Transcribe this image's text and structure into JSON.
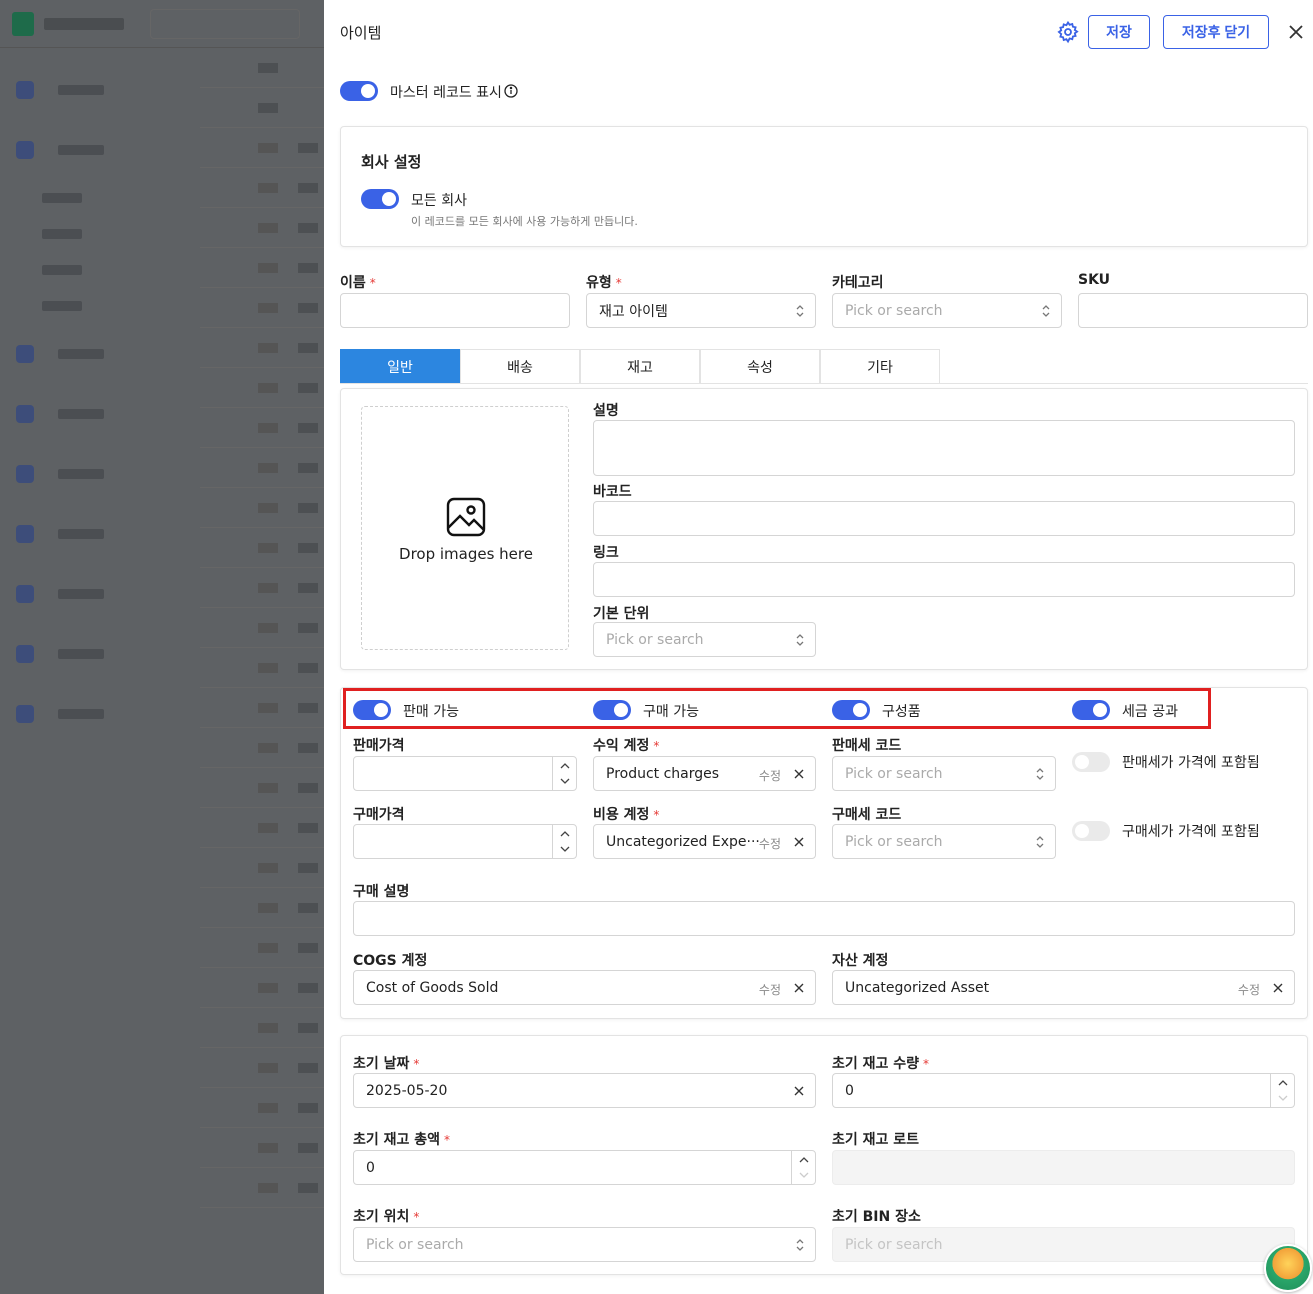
{
  "panel": {
    "title": "아이템",
    "save_label": "저장",
    "save_close_label": "저장후 닫기"
  },
  "master": {
    "toggle_label": "마스터 레코드 표시",
    "on": true
  },
  "company": {
    "heading": "회사 설정",
    "all_label": "모든 회사",
    "all_hint": "이 레코드를 모든 회사에 사용 가능하게 만듭니다.",
    "all_on": true
  },
  "top_fields": {
    "name": {
      "label": "이름",
      "value": ""
    },
    "type": {
      "label": "유형",
      "value": "재고 아이템"
    },
    "category": {
      "label": "카테고리",
      "placeholder": "Pick or search"
    },
    "sku": {
      "label": "SKU",
      "value": ""
    }
  },
  "tabs": [
    "일반",
    "배송",
    "재고",
    "속성",
    "기타"
  ],
  "active_tab": "일반",
  "general": {
    "drop_text": "Drop images here",
    "description_label": "설명",
    "barcode_label": "바코드",
    "link_label": "링크",
    "unit_label": "기본 단위",
    "unit_placeholder": "Pick or search"
  },
  "flags": [
    {
      "label": "판매 가능",
      "on": true
    },
    {
      "label": "구매 가능",
      "on": true
    },
    {
      "label": "구성품",
      "on": true
    },
    {
      "label": "세금 공과",
      "on": true
    }
  ],
  "pricing": {
    "sale_price_label": "판매가격",
    "income_account_label": "수익 계정",
    "income_account_value": "Product charges",
    "sale_tax_label": "판매세 코드",
    "sale_tax_placeholder": "Pick or search",
    "sale_tax_included_label": "판매세가 가격에 포함됨",
    "purchase_price_label": "구매가격",
    "expense_account_label": "비용 계정",
    "expense_account_value": "Uncategorized Expe···",
    "purchase_tax_label": "구매세 코드",
    "purchase_tax_placeholder": "Pick or search",
    "purchase_tax_included_label": "구매세가 가격에 포함됨",
    "purchase_desc_label": "구매 설명",
    "cogs_label": "COGS 계정",
    "cogs_value": "Cost of Goods Sold",
    "asset_label": "자산 계정",
    "asset_value": "Uncategorized Asset",
    "edit_label": "수정"
  },
  "initial": {
    "date_label": "초기 날짜",
    "date_value": "2025-05-20",
    "qty_label": "초기 재고 수량",
    "qty_value": "0",
    "total_label": "초기 재고 총액",
    "total_value": "0",
    "lot_label": "초기 재고 로트",
    "location_label": "초기 위치",
    "location_placeholder": "Pick or search",
    "bin_label": "초기 BIN 장소",
    "bin_placeholder": "Pick or search"
  },
  "required_mark": "*",
  "colors": {
    "accent": "#3a62e6",
    "tab_active": "#2c86e0",
    "highlight": "#e02020"
  }
}
